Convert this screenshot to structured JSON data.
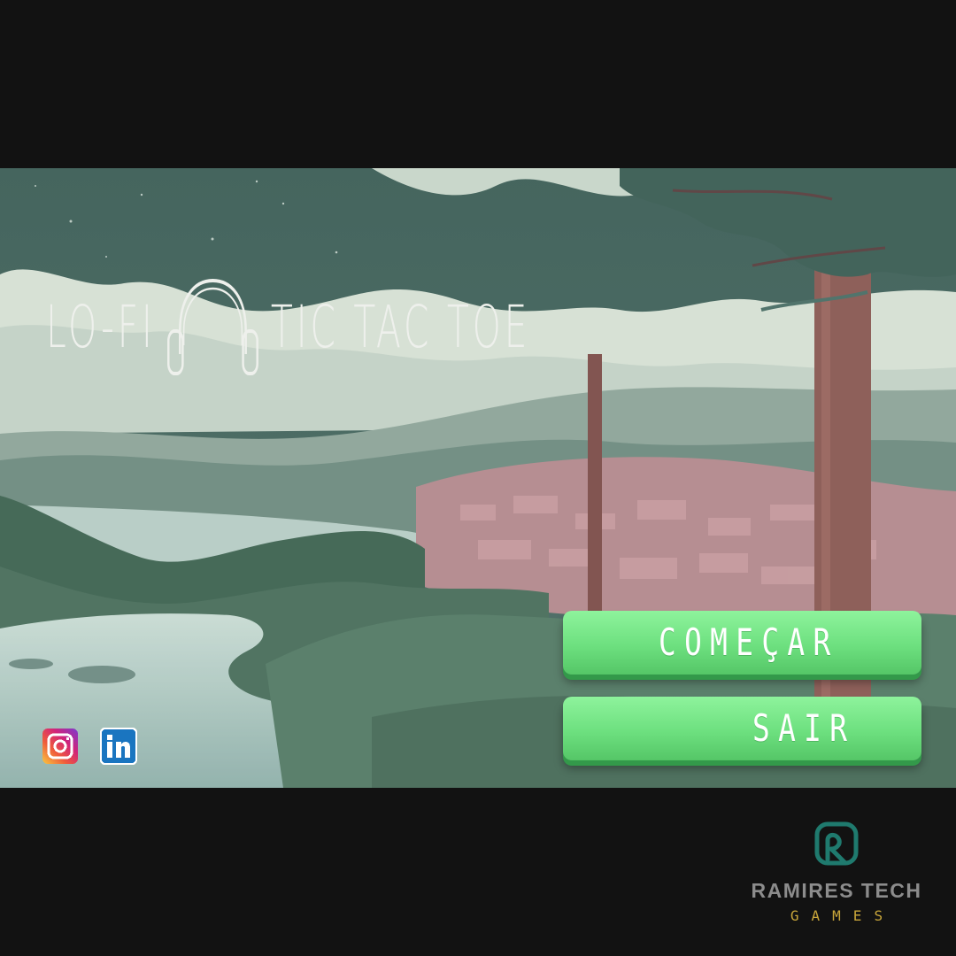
{
  "game": {
    "title_left": "LO-FI",
    "title_right": "TIC TAC TOE",
    "title_icon": "headphones-icon"
  },
  "menu": {
    "start_label": "COMEÇAR",
    "exit_label": "SAIR",
    "button_color": "#6de07f"
  },
  "social": {
    "instagram_icon": "instagram-icon",
    "linkedin_icon": "linkedin-icon"
  },
  "brand": {
    "name": "RAMIRES TECH",
    "subtitle": "GAMES",
    "logo_icon": "ramires-tech-logo-icon",
    "name_color": "#8c8c8c",
    "subtitle_color": "#c9a63a"
  }
}
